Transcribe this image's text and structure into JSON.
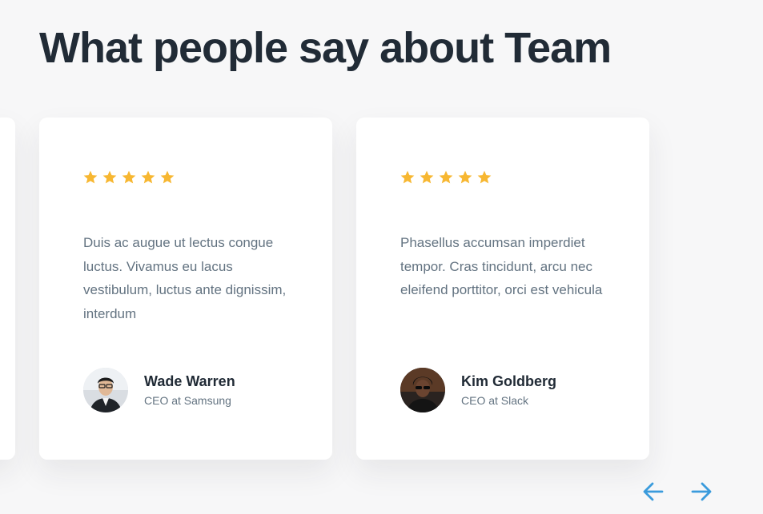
{
  "section": {
    "title": "What people say about Team"
  },
  "colors": {
    "star": "#F7B731",
    "heading": "#212B36",
    "body_text": "#637381",
    "arrow": "#3A9BDC",
    "background": "#F7F7F8"
  },
  "testimonials": [
    {
      "rating": 5,
      "quote": "Duis ac augue ut lectus congue luctus. Vivamus eu lacus vestibulum, luctus ante dignissim, interdum",
      "name": "Wade Warren",
      "role": "CEO at Samsung",
      "avatar_icon": "user-avatar-wade"
    },
    {
      "rating": 5,
      "quote": "Phasellus accumsan imperdiet tempor. Cras tincidunt, arcu nec eleifend porttitor, orci est vehicula",
      "name": "Kim Goldberg",
      "role": "CEO at Slack",
      "avatar_icon": "user-avatar-kim"
    }
  ],
  "carousel": {
    "prev_icon": "arrow-left-icon",
    "next_icon": "arrow-right-icon"
  }
}
